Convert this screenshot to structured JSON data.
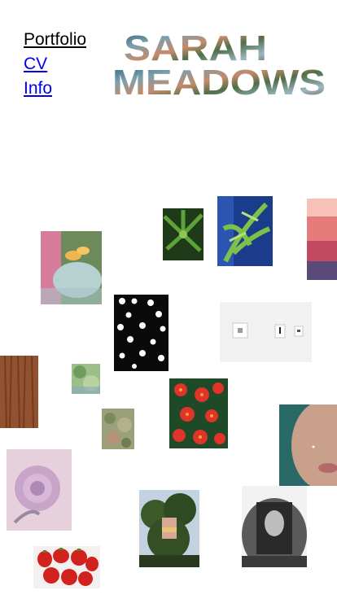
{
  "site": {
    "logo_line1": "SARAH",
    "logo_line2": "MEADOWS"
  },
  "nav": {
    "portfolio": "Portfolio",
    "cv": "CV",
    "info": "Info"
  },
  "colors": {
    "link": "#0000ee",
    "active_link": "#000000",
    "background": "#ffffff"
  },
  "gallery": [
    {
      "name": "hand-with-flower-photo"
    },
    {
      "name": "green-leaves-photo"
    },
    {
      "name": "blue-leaves-photo"
    },
    {
      "name": "pink-sea-photo"
    },
    {
      "name": "light-dots-photo"
    },
    {
      "name": "gallery-wall-photo"
    },
    {
      "name": "wood-grain-photo"
    },
    {
      "name": "small-green-photo"
    },
    {
      "name": "red-flowers-photo"
    },
    {
      "name": "moss-photo"
    },
    {
      "name": "face-closeup-photo"
    },
    {
      "name": "pink-rose-photo"
    },
    {
      "name": "tree-sunset-photo"
    },
    {
      "name": "grey-rock-photo"
    },
    {
      "name": "strawberries-photo"
    }
  ]
}
